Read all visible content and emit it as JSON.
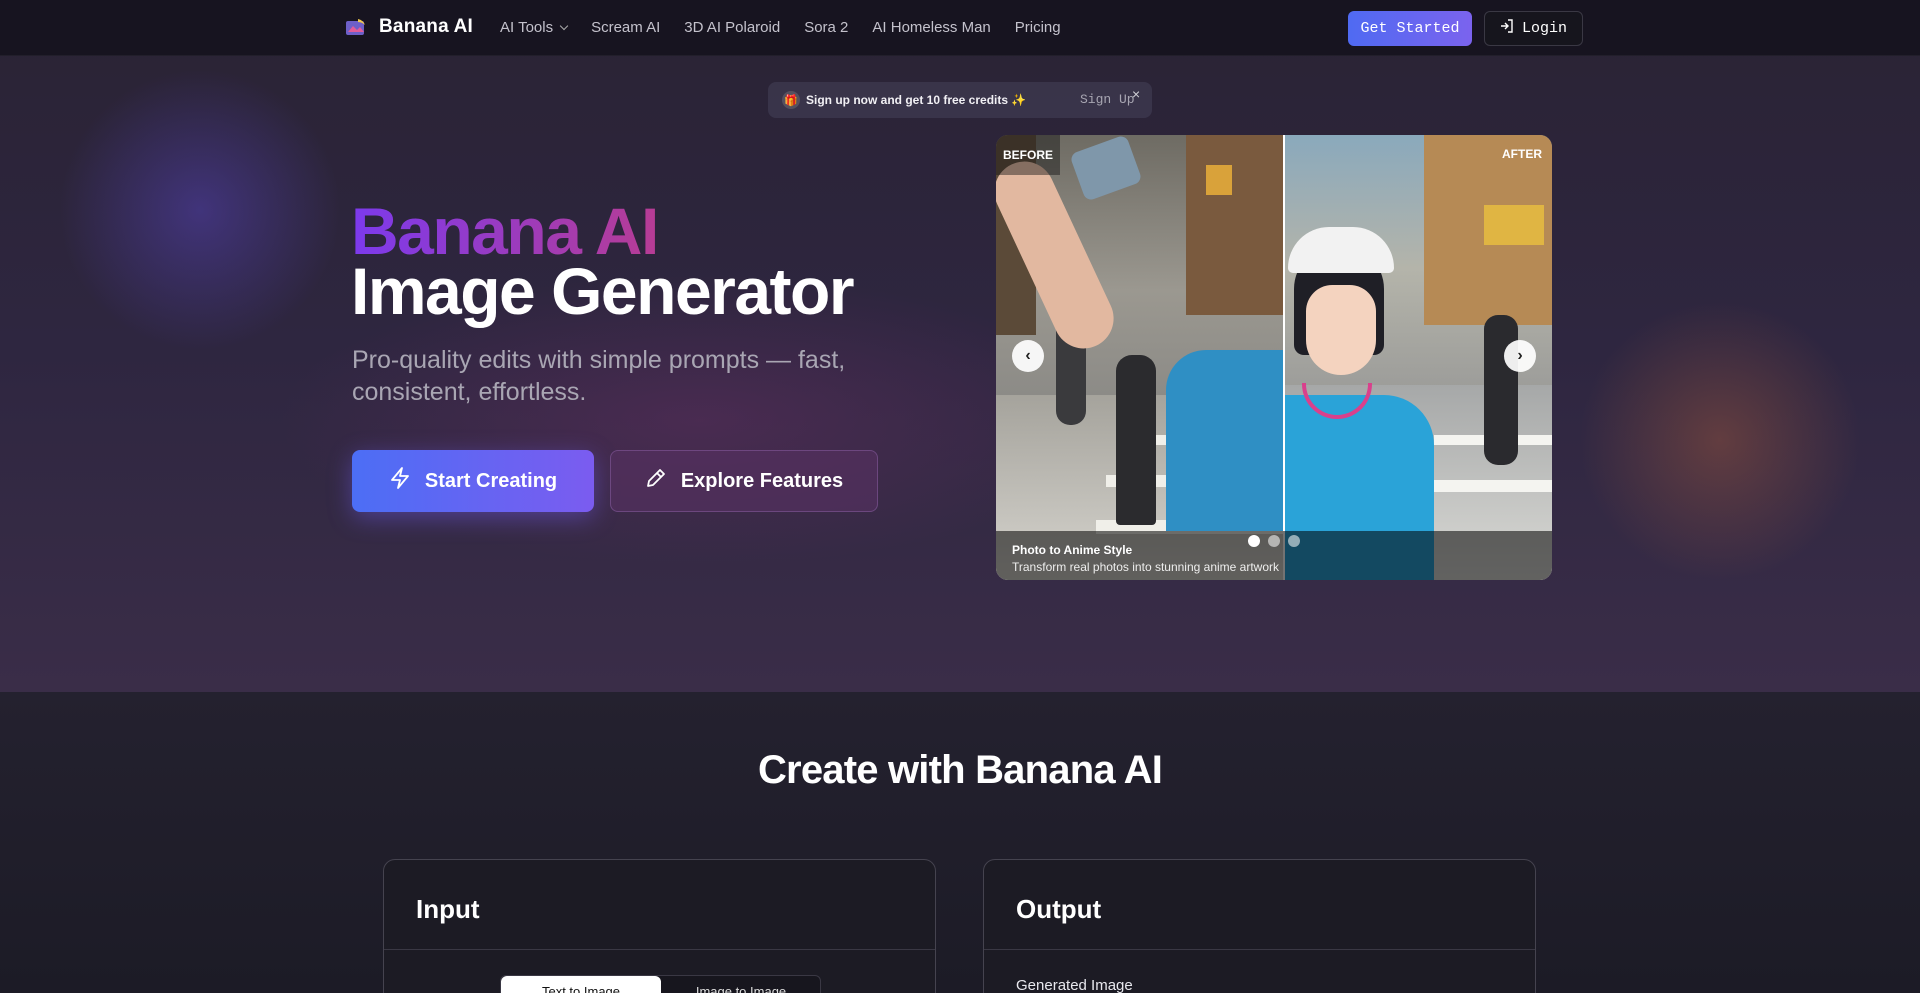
{
  "nav": {
    "brand": "Banana AI",
    "links": [
      "AI Tools",
      "Scream AI",
      "3D AI Polaroid",
      "Sora 2",
      "AI Homeless Man",
      "Pricing"
    ],
    "get_started": "Get Started",
    "login": "Login"
  },
  "promo": {
    "text": "Sign up now and get 10 free credits",
    "signup": "Sign Up",
    "close": "×"
  },
  "hero": {
    "title_line1": "Banana AI",
    "title_line2": "Image Generator",
    "subtitle": "Pro-quality edits with simple prompts — fast, consistent, effortless.",
    "start_label": "Start Creating",
    "explore_label": "Explore Features"
  },
  "compare": {
    "before_label": "BEFORE",
    "after_label": "AFTER",
    "caption_title": "Photo to Anime Style",
    "caption_desc": "Transform real photos into stunning anime artwork",
    "prev": "‹",
    "next": "›",
    "active_slide": 1,
    "slide_count": 3
  },
  "section": {
    "title": "Create with Banana AI",
    "input": {
      "heading": "Input",
      "tabs": [
        "Text to Image",
        "Image to Image"
      ],
      "active_tab": "Text to Image"
    },
    "output": {
      "heading": "Output",
      "label": "Generated Image"
    }
  },
  "colors": {
    "accent_blue": "#4c6ef5",
    "accent_purple": "#7b5cf0",
    "title_gradient_start": "#7c3aed",
    "title_gradient_end": "#b73c94"
  }
}
